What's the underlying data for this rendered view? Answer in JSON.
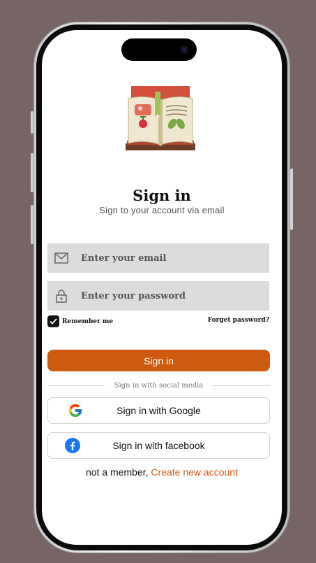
{
  "colors": {
    "background": "#766564",
    "accent": "#cd5a0e",
    "field_bg": "#dcdcdc"
  },
  "header": {
    "title": "Sign in",
    "subtitle": "Sign to your account via email"
  },
  "logo": {
    "icon": "recipe-book-icon"
  },
  "form": {
    "email": {
      "icon": "mail-icon",
      "placeholder": "Enter your email",
      "value": ""
    },
    "password": {
      "icon": "lock-icon",
      "placeholder": "Enter your password",
      "value": ""
    },
    "remember": {
      "label": "Remember me",
      "checked": true
    },
    "forgot_label": "Forget password?",
    "submit_label": "Sign in"
  },
  "social": {
    "divider_text": "Sign in with social media",
    "google": {
      "icon": "google-icon",
      "label": "Sign in with Google"
    },
    "facebook": {
      "icon": "facebook-icon",
      "label": "Sign in with facebook"
    }
  },
  "footer": {
    "prompt": "not a member,",
    "link_label": "Create new account"
  }
}
